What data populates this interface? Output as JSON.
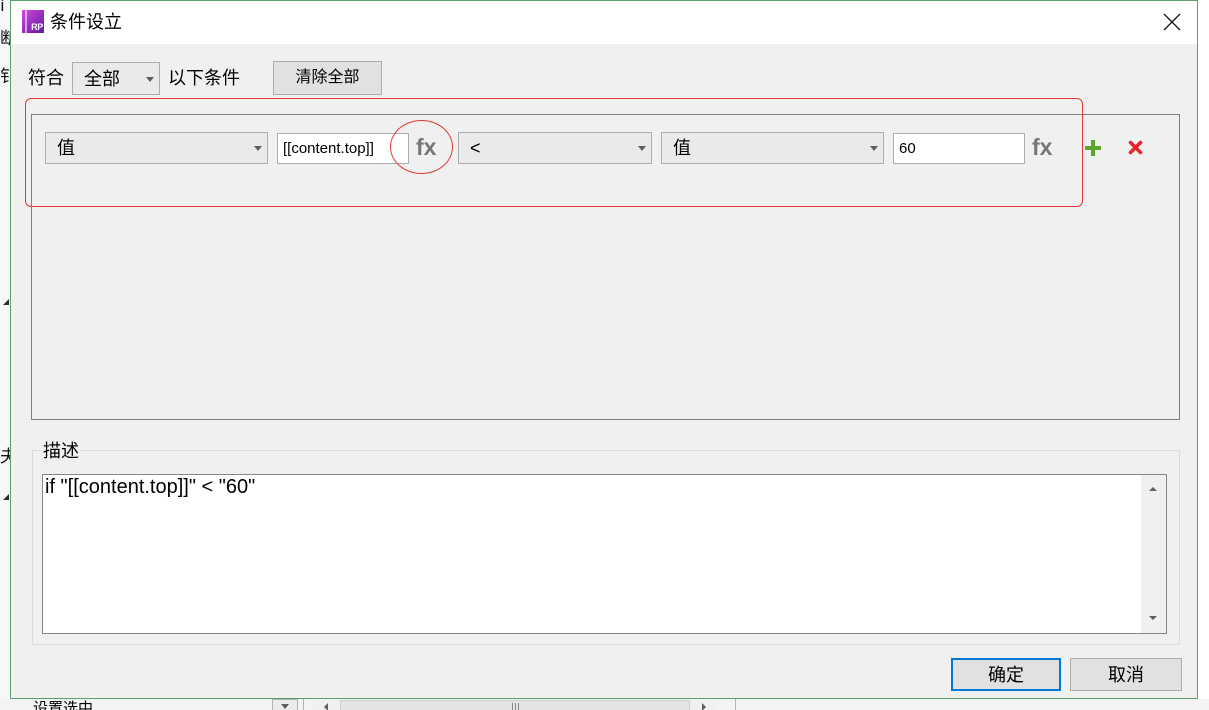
{
  "window": {
    "title": "条件设立",
    "icon_text": "RP",
    "icons": {
      "app": "axure-rp-app-icon",
      "close": "close-icon"
    }
  },
  "background_window": {
    "left_fragments": [
      "ì",
      "断",
      "钅",
      "夫"
    ],
    "bottom": {
      "tree_item_label": "设置选中"
    },
    "icons": {
      "expand": "tree-expand-icon",
      "dropdown": "chevron-down-icon",
      "scroll_left": "arrow-left-icon",
      "scroll_right": "arrow-right-icon",
      "grip": "scroll-grip-icon"
    }
  },
  "match_row": {
    "prefix": "符合",
    "mode_selected": "全部",
    "suffix": "以下条件",
    "clear_all_label": "清除全部"
  },
  "conditions": [
    {
      "left_type": "值",
      "left_value": "[[content.top]]",
      "left_fx_label": "fx",
      "operator": "<",
      "right_type": "值",
      "right_value": "60",
      "right_fx_label": "fx",
      "icons": {
        "add": "plus-icon",
        "remove": "delete-x-icon",
        "dropdown": "chevron-down-icon"
      }
    }
  ],
  "description": {
    "label": "描述",
    "text": "if \"[[content.top]]\" < \"60\"",
    "icons": {
      "scroll_up": "arrow-up-icon",
      "scroll_down": "arrow-down-icon"
    }
  },
  "footer": {
    "ok_label": "确定",
    "cancel_label": "取消"
  },
  "colors": {
    "window_border": "#5d9e6e",
    "dialog_bg": "#f0f0f0",
    "annotation_red": "#e53935",
    "add_green": "#5aa72c",
    "remove_red": "#e8242c",
    "default_button_border": "#0078d7",
    "fx_gray": "#777777"
  }
}
